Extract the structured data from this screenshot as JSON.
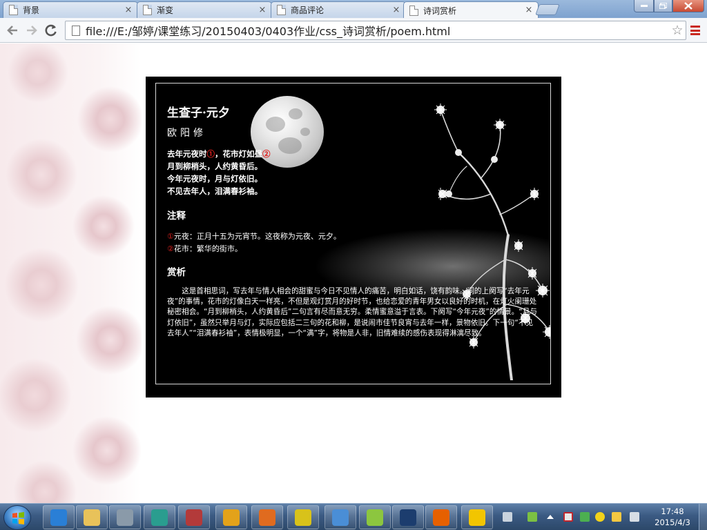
{
  "browser": {
    "tabs": [
      {
        "label": "背景",
        "active": false
      },
      {
        "label": "渐变",
        "active": false
      },
      {
        "label": "商品评论",
        "active": false
      },
      {
        "label": "诗词赏析",
        "active": true
      }
    ],
    "close_glyph": "×",
    "url": "file:///E:/邹婷/课堂练习/20150403/0403作业/css_诗词赏析/poem.html",
    "icons": {
      "back": "back-arrow-icon",
      "forward": "forward-arrow-icon",
      "reload": "reload-icon",
      "page": "page-icon",
      "bookmark": "star-icon",
      "menu": "hamburger-menu-icon"
    },
    "colors": {
      "menu_accent": "#c9281f",
      "close_button": "#c74a33"
    }
  },
  "poem": {
    "title": "生查子·元夕",
    "author": "欧阳修",
    "lines": [
      {
        "before": "去年元夜时",
        "mark": "①",
        "after": "，花市灯如昼",
        "mark2": "②"
      },
      {
        "before": "月到柳梢头，人约黄昏后。",
        "mark": "",
        "after": "",
        "mark2": ""
      },
      {
        "before": "今年元夜时，月与灯依旧。",
        "mark": "",
        "after": "",
        "mark2": ""
      },
      {
        "before": "不见去年人，泪满春衫袖。",
        "mark": "",
        "after": "",
        "mark2": ""
      }
    ],
    "notes_heading": "注释",
    "notes": [
      {
        "mark": "①",
        "text": "元夜：正月十五为元宵节。这夜称为元夜、元夕。"
      },
      {
        "mark": "②",
        "text": "花市：繁华的街市。"
      }
    ],
    "analysis_heading": "赏析",
    "analysis": "这是首相思词，写去年与情人相会的甜蜜与今日不见情人的痛苦，明白如话，饶有韵味。词的上阕写“去年元夜”的事情，花市的灯像白天一样亮，不但是观灯赏月的好时节，也给恋爱的青年男女以良好的时机，在灯火阑珊处秘密相会。“月到柳梢头，人约黄昏后”二句言有尽而意无穷。柔情蜜意溢于言表。下阕写“今年元夜”的情景。“月与灯依旧”，虽然只举月与灯，实际应包括二三句的花和柳，是说闹市佳节良宵与去年一样，景物依旧。下一句“不见去年人”“泪满春衫袖”，表情极明显，一个“满”字，将物是人非，旧情难续的感伤表现得淋漓尽致。",
    "colors": {
      "note_mark": "#e1201e",
      "text": "#ffffff",
      "frame": "#000000"
    }
  },
  "taskbar": {
    "apps": [
      {
        "icon": "internet-explorer-icon",
        "color": "#2a7fd6"
      },
      {
        "icon": "file-explorer-icon",
        "color": "#e8c25a"
      },
      {
        "icon": "server-manager-icon",
        "color": "#8a9aa9"
      },
      {
        "icon": "editor-app-icon",
        "color": "#2a9d8f"
      },
      {
        "icon": "installer-app-icon",
        "color": "#b33a3a"
      },
      {
        "icon": "chrome-icon",
        "color": "#e3a21a"
      },
      {
        "icon": "presentation-app-icon",
        "color": "#e06b1f"
      },
      {
        "icon": "help-app-icon",
        "color": "#d8c21a"
      },
      {
        "icon": "photo-viewer-icon",
        "color": "#4a8ed6"
      },
      {
        "icon": "drop-app-icon",
        "color": "#8cc63f"
      },
      {
        "icon": "photoshop-icon",
        "color": "#1c3d6e"
      },
      {
        "icon": "firefox-icon",
        "color": "#e66000"
      },
      {
        "icon": "ie-tester-icon",
        "color": "#f2c500"
      }
    ],
    "tray_icons": [
      "keyboard-icon",
      "battery-icon",
      "show-hidden-icon",
      "network-icon",
      "security-icon",
      "add-icon",
      "flag-icon",
      "volume-icon"
    ],
    "time": "17:48",
    "date": "2015/4/3"
  }
}
